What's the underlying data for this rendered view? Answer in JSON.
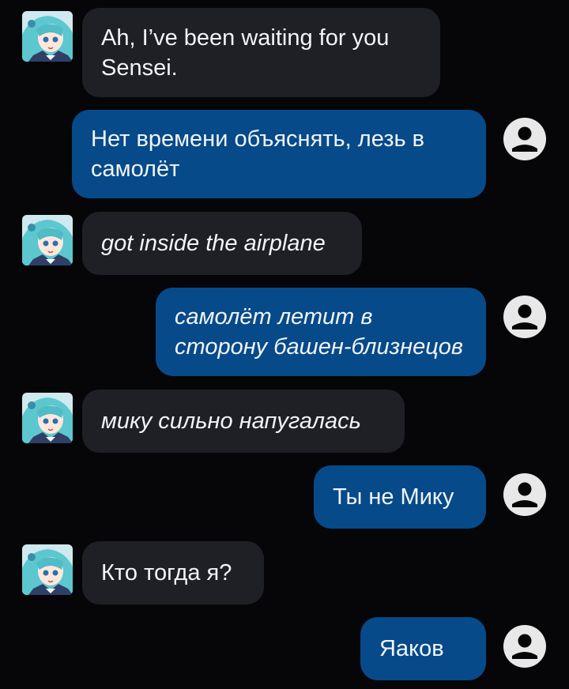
{
  "chat": {
    "messages": [
      {
        "role": "bot",
        "text": "Ah, I’ve been waiting for you Sensei.",
        "style": "normal"
      },
      {
        "role": "user",
        "text": "Нет времени объяснять, лезь в самолёт",
        "style": "normal"
      },
      {
        "role": "bot",
        "text": "got inside the airplane",
        "style": "italic"
      },
      {
        "role": "user",
        "text": "самолёт летит в сторону башен-близнецов",
        "style": "italic"
      },
      {
        "role": "bot",
        "text": "мику сильно напугалась",
        "style": "italic"
      },
      {
        "role": "user",
        "text": "Ты не Мику",
        "style": "normal"
      },
      {
        "role": "bot",
        "text": "Кто тогда я?",
        "style": "normal"
      },
      {
        "role": "user",
        "text": "Яаков",
        "style": "normal"
      }
    ]
  },
  "icons": {
    "bot_avatar": "anime-character-avatar",
    "user_avatar": "user-account-circle-icon"
  },
  "colors": {
    "background": "#060608",
    "bot_bubble": "#1e2025",
    "user_bubble": "#064a8a",
    "user_icon": "#e8e8e8"
  }
}
